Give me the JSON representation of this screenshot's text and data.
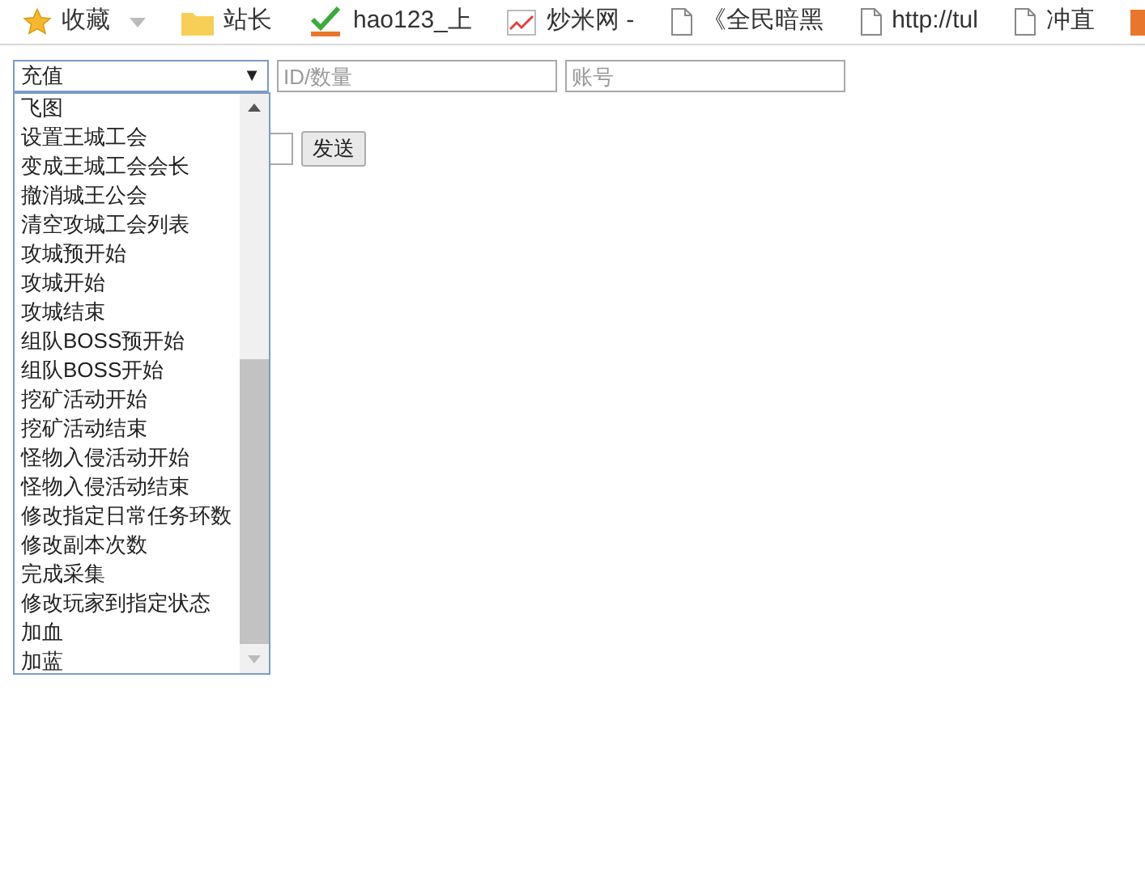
{
  "bookmarks": [
    {
      "label": "收藏",
      "kind": "star",
      "has_menu": true
    },
    {
      "label": "站长",
      "kind": "folder",
      "has_menu": false
    },
    {
      "label": "hao123_上",
      "kind": "hao",
      "has_menu": false
    },
    {
      "label": "炒米网 -",
      "kind": "chart",
      "has_menu": false
    },
    {
      "label": "《全民暗黑",
      "kind": "page",
      "has_menu": false
    },
    {
      "label": "http://tul",
      "kind": "page",
      "has_menu": false
    },
    {
      "label": "冲直",
      "kind": "page",
      "has_menu": false
    }
  ],
  "form": {
    "select": {
      "value": "充值",
      "arrow": "▼"
    },
    "id_field": {
      "placeholder": "ID/数量"
    },
    "account_field": {
      "placeholder": "账号"
    },
    "send_button": {
      "label": "发送"
    }
  },
  "dropdown": {
    "items": [
      {
        "label": "飞图"
      },
      {
        "label": "设置王城工会"
      },
      {
        "label": "变成王城工会会长"
      },
      {
        "label": "撤消城王公会"
      },
      {
        "label": "清空攻城工会列表"
      },
      {
        "label": "攻城预开始"
      },
      {
        "label": "攻城开始"
      },
      {
        "label": "攻城结束"
      },
      {
        "label": "组队BOSS预开始"
      },
      {
        "label": "组队BOSS开始"
      },
      {
        "label": "挖矿活动开始"
      },
      {
        "label": "挖矿活动结束"
      },
      {
        "label": "怪物入侵活动开始"
      },
      {
        "label": "怪物入侵活动结束"
      },
      {
        "label": "修改指定日常任务环数"
      },
      {
        "label": "修改副本次数"
      },
      {
        "label": "完成采集"
      },
      {
        "label": "修改玩家到指定状态"
      },
      {
        "label": "加血"
      },
      {
        "label": "加蓝"
      }
    ]
  }
}
